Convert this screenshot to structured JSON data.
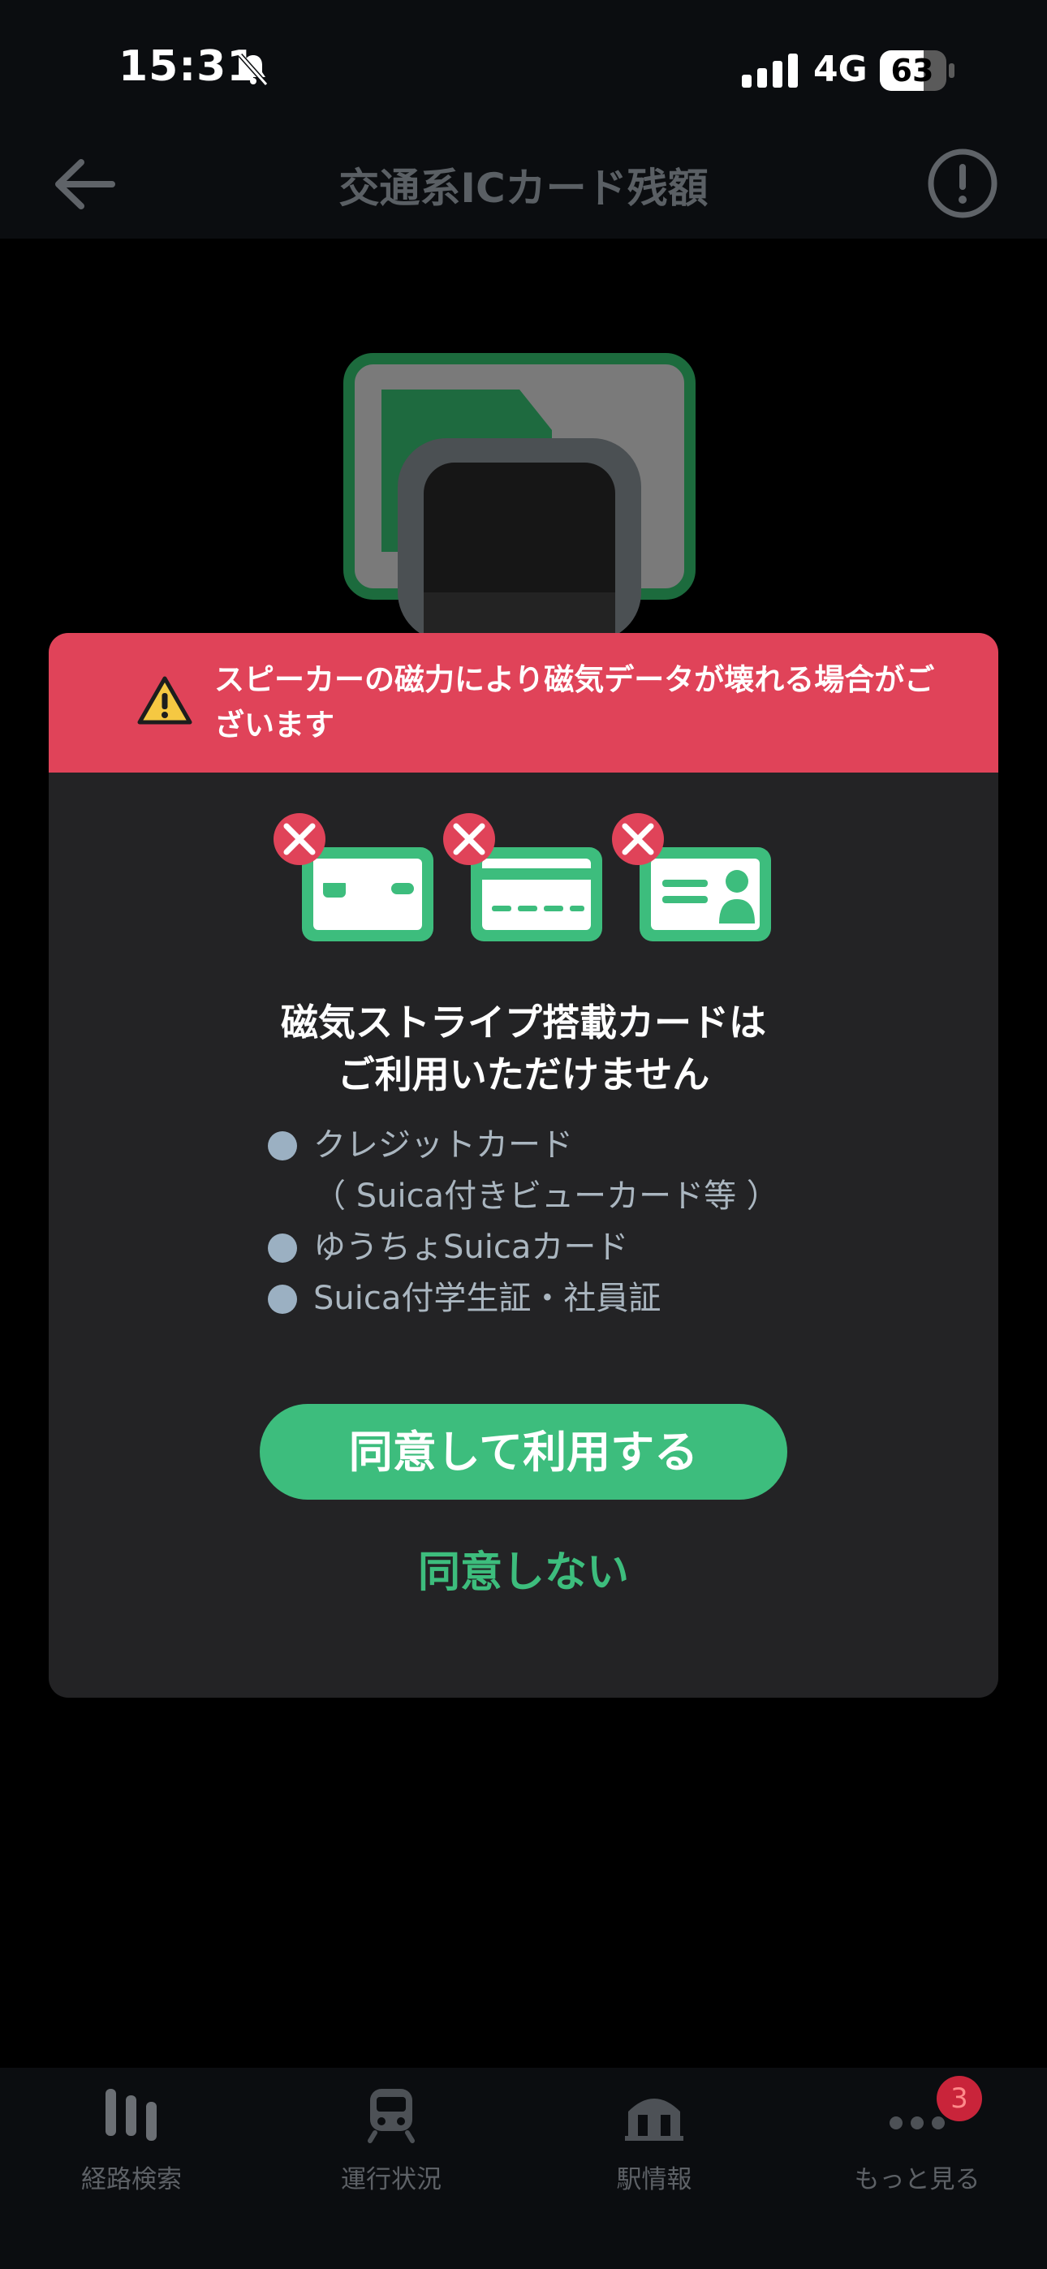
{
  "status_bar": {
    "time": "15:31",
    "network": "4G",
    "battery": "63"
  },
  "header": {
    "title": "交通系ICカード残額"
  },
  "modal": {
    "warning": "スピーカーの磁力により磁気データが壊れる場合がございます",
    "heading_line1": "磁気ストライプ搭載カードは",
    "heading_line2": "ご利用いただけません",
    "items": [
      "クレジットカード",
      "（ Suica付きビューカード等 ）",
      "ゆうちょSuicaカード",
      "Suica付学生証・社員証"
    ],
    "agree_label": "同意して利用する",
    "disagree_label": "同意しない"
  },
  "bottom_nav": {
    "tabs": [
      {
        "label": "経路検索",
        "icon": "route-search-icon"
      },
      {
        "label": "運行状況",
        "icon": "train-icon"
      },
      {
        "label": "駅情報",
        "icon": "station-icon"
      },
      {
        "label": "もっと見る",
        "icon": "more-icon"
      }
    ],
    "badge": "3"
  },
  "colors": {
    "accent": "#3dbd7d",
    "warning": "#e04359",
    "modal_bg": "#232325"
  }
}
